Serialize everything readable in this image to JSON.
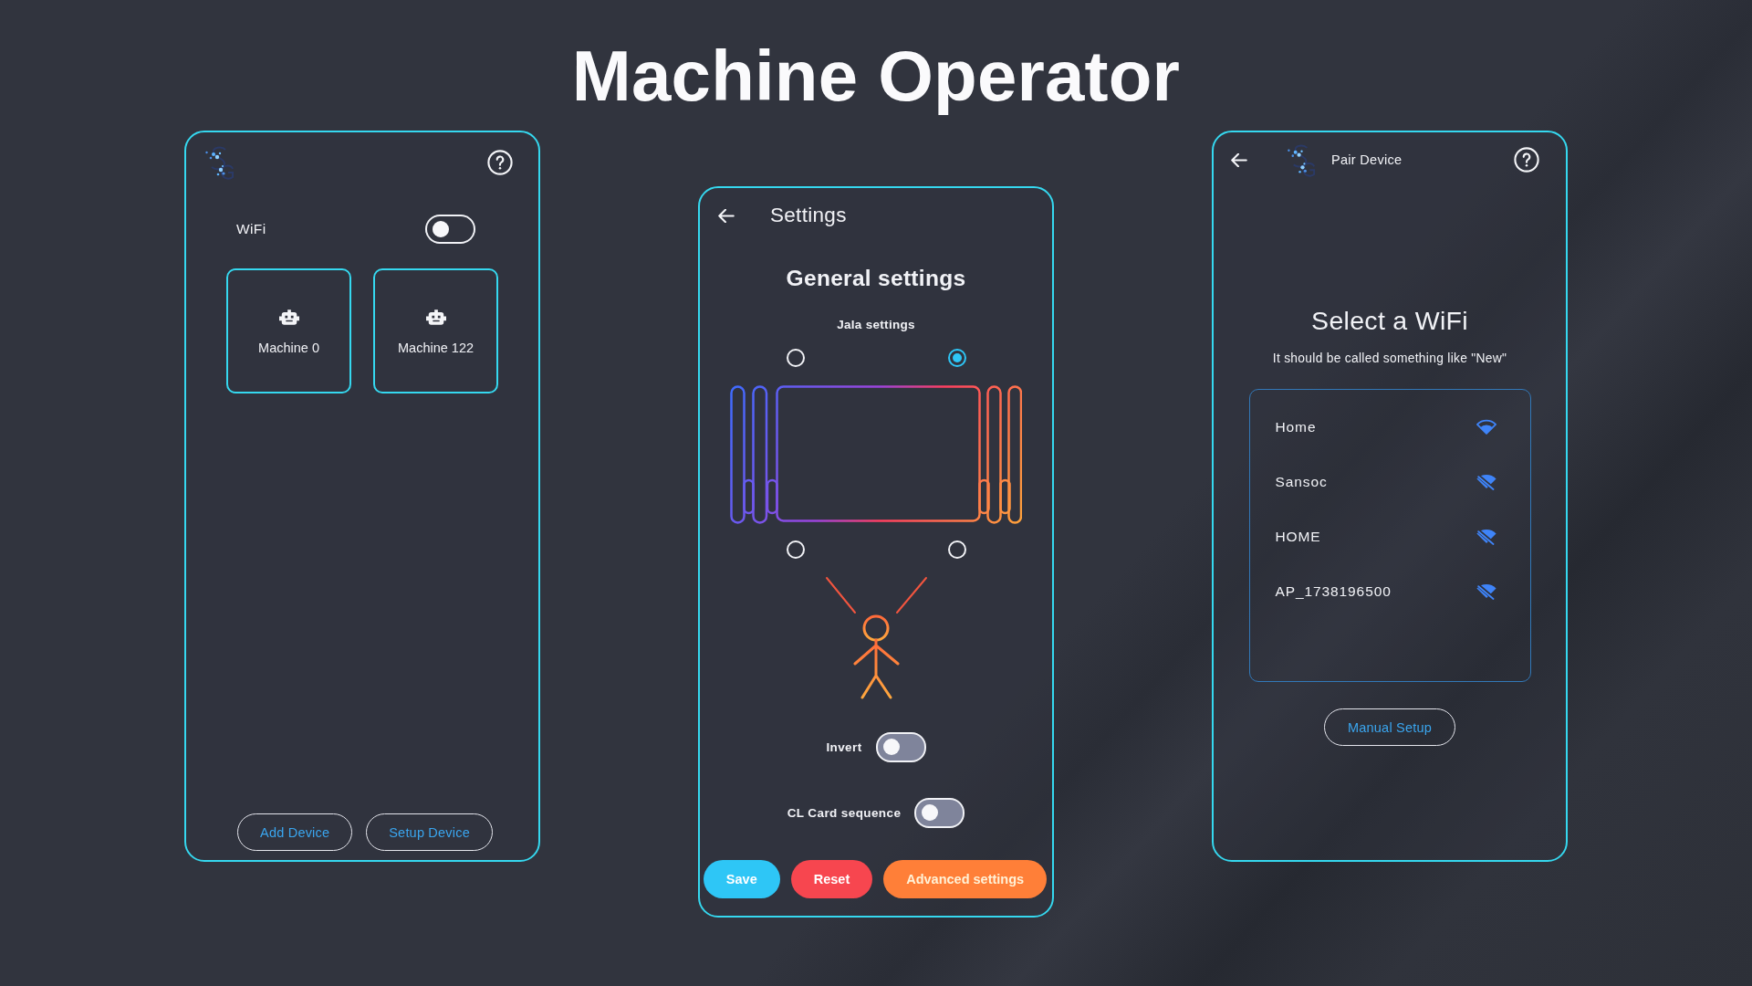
{
  "title": "Machine Operator",
  "home_screen": {
    "wifi": {
      "label": "WiFi",
      "on": false
    },
    "machines": [
      {
        "name": "Machine 0"
      },
      {
        "name": "Machine 122"
      }
    ],
    "buttons": [
      "Add Device",
      "Setup Device"
    ]
  },
  "settings_screen": {
    "title": "Settings",
    "heading": "General settings",
    "section": "Jala settings",
    "positions": [
      {
        "selected": false
      },
      {
        "selected": true
      },
      {
        "selected": false
      },
      {
        "selected": false
      }
    ],
    "toggles": [
      {
        "label": "Invert",
        "on": false
      },
      {
        "label": "CL Card sequence",
        "on": false
      }
    ],
    "buttons": [
      {
        "label": "Save",
        "color": "#2ec6f6"
      },
      {
        "label": "Reset",
        "color": "#f7464f"
      },
      {
        "label": "Advanced settings",
        "color": "#ff7f38"
      }
    ]
  },
  "pair_screen": {
    "title": "Pair Device",
    "heading": "Select a WiFi",
    "hint": "It should be called something like \"New\"",
    "networks": [
      {
        "name": "Home",
        "kind": "signal"
      },
      {
        "name": "Sansoc",
        "kind": "off"
      },
      {
        "name": "HOME",
        "kind": "off"
      },
      {
        "name": "AP_1738196500",
        "kind": "off"
      }
    ],
    "button": "Manual Setup"
  }
}
